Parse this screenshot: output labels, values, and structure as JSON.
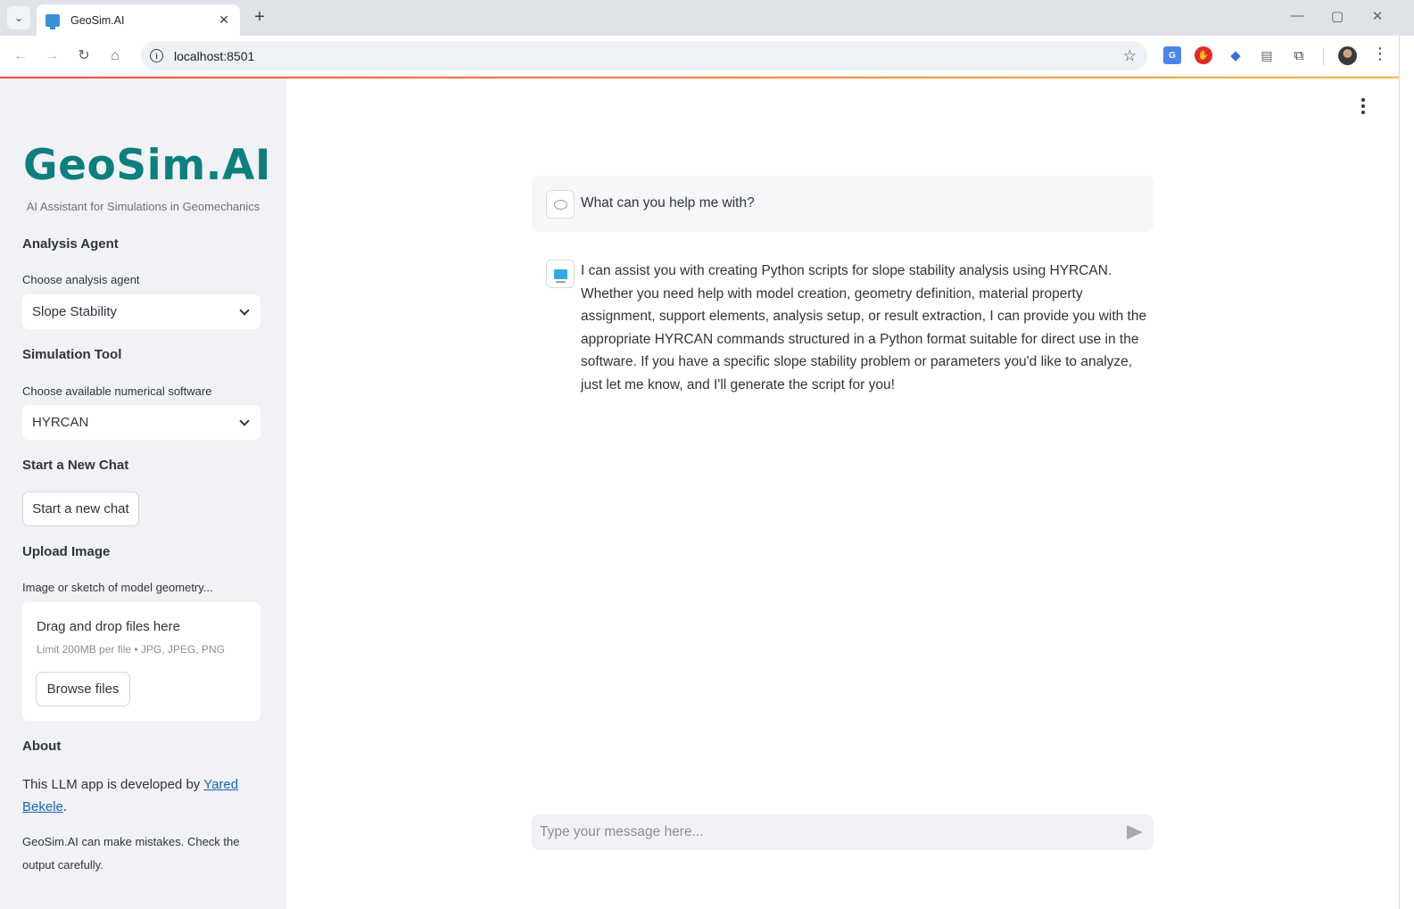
{
  "browser": {
    "tab_title": "GeoSim.AI",
    "tab_close": "✕",
    "new_tab": "+",
    "url": "localhost:8501",
    "info_glyph": "i",
    "star_glyph": "☆",
    "back_glyph": "←",
    "forward_glyph": "→",
    "reload_glyph": "↻",
    "home_glyph": "⌂",
    "minimize_glyph": "—",
    "maximize_glyph": "▢",
    "close_glyph": "✕",
    "menu_glyph": "⋮",
    "tab_search_glyph": "⌄",
    "extension_icons": [
      "translate-icon",
      "stop-icon",
      "graduation-cap-icon",
      "document-icon",
      "puzzle-icon"
    ]
  },
  "sidebar": {
    "logo": "GeoSim.AI",
    "tagline": "AI Assistant for Simulations in Geomechanics",
    "analysis_heading": "Analysis Agent",
    "analysis_label": "Choose analysis agent",
    "analysis_value": "Slope Stability",
    "sim_heading": "Simulation Tool",
    "sim_label": "Choose available numerical software",
    "sim_value": "HYRCAN",
    "new_chat_heading": "Start a New Chat",
    "new_chat_button": "Start a new chat",
    "upload_heading": "Upload Image",
    "upload_label": "Image or sketch of model geometry...",
    "drop_title": "Drag and drop files here",
    "drop_limit": "Limit 200MB per file • JPG, JPEG, PNG",
    "browse_button": "Browse files",
    "about_heading": "About",
    "about_prefix": "This LLM app is developed by ",
    "about_link": "Yared Bekele",
    "about_suffix": ".",
    "disclaimer": "GeoSim.AI can make mistakes. Check the output carefully."
  },
  "chat": {
    "user_message": "What can you help me with?",
    "assistant_message": "I can assist you with creating Python scripts for slope stability analysis using HYRCAN. Whether you need help with model creation, geometry definition, material property assignment, support elements, analysis setup, or result extraction, I can provide you with the appropriate HYRCAN commands structured in a Python format suitable for direct use in the software. If you have a specific slope stability problem or parameters you'd like to analyze, just let me know, and I'll generate the script for you!",
    "input_placeholder": "Type your message here..."
  },
  "colors": {
    "logo": "#0e7f7d",
    "sidebar_bg": "#f0f2f6",
    "link": "#1a64b8",
    "accent_gradient_start": "#ff4b4b",
    "accent_gradient_end": "#ffbd45"
  }
}
